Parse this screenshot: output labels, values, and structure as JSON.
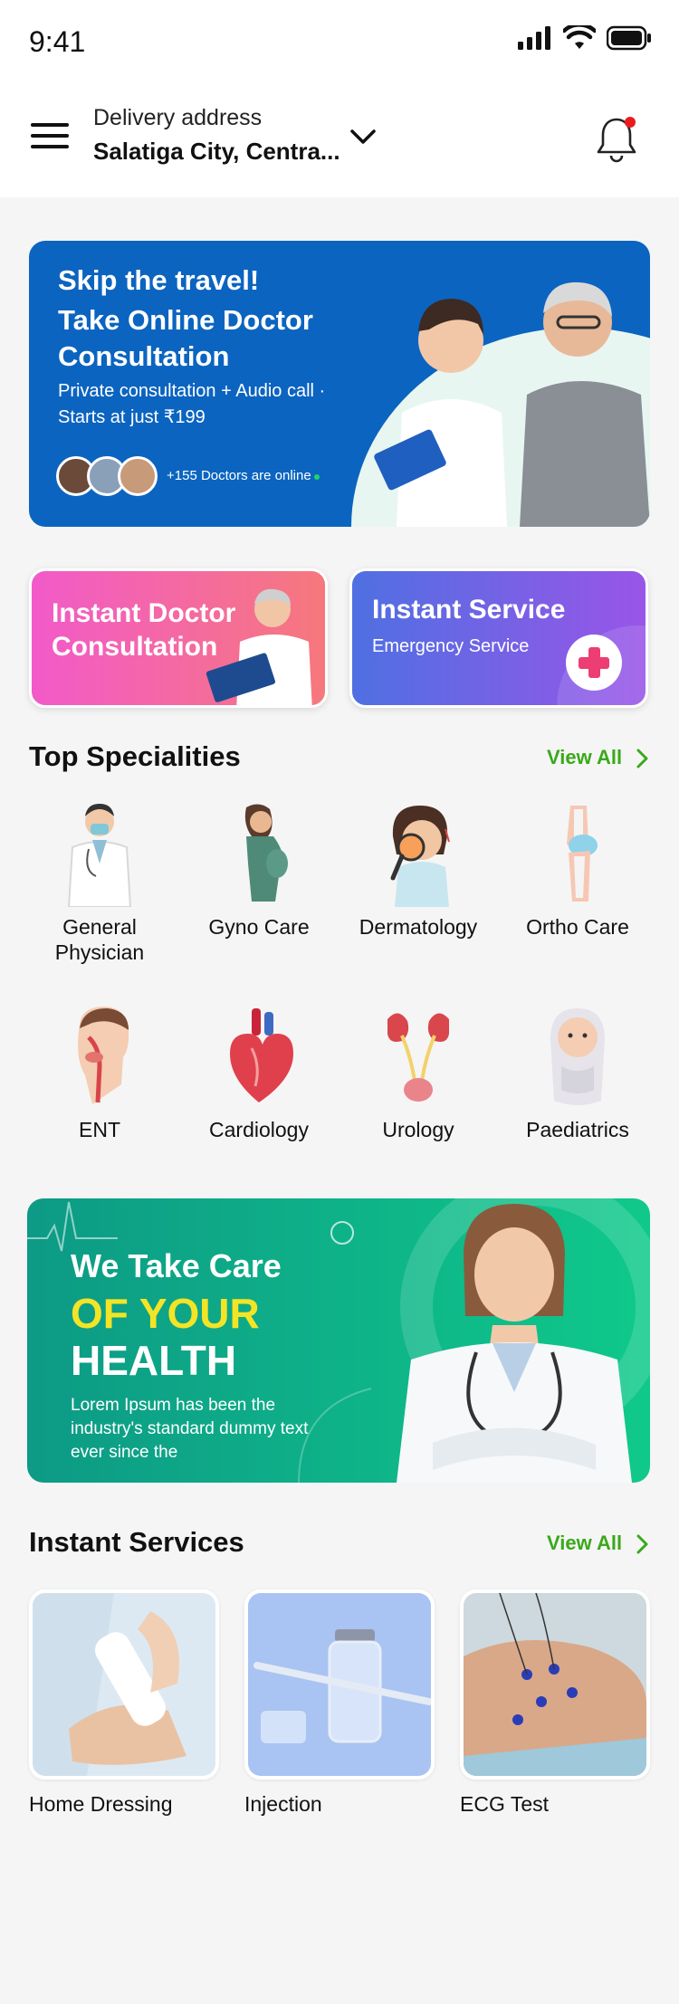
{
  "status_bar": {
    "time": "9:41"
  },
  "header": {
    "address_label": "Delivery address",
    "address_value": "Salatiga City, Centra...",
    "icons": [
      "menu-icon",
      "chevron-down-icon",
      "bell-icon"
    ],
    "notification_dot_color": "#e81c1c"
  },
  "hero": {
    "tagline": "Skip the travel!",
    "title": "Take Online Doctor Consultation",
    "subtitle": "Private consultation + Audio call · Starts at just ₹199",
    "online_text": "+155 Doctors are online",
    "background_color": "#0b64c0"
  },
  "quick_cards": [
    {
      "title": "Instant Doctor Consultation",
      "subtitle": ""
    },
    {
      "title": "Instant Service",
      "subtitle": "Emergency Service"
    }
  ],
  "specialities": {
    "title": "Top Specialities",
    "view_all": "View All",
    "items": [
      {
        "label": "General Physician",
        "icon": "doctor-icon"
      },
      {
        "label": "Gyno Care",
        "icon": "pregnant-woman-icon"
      },
      {
        "label": "Dermatology",
        "icon": "skin-magnifier-icon"
      },
      {
        "label": "Ortho Care",
        "icon": "knee-joint-icon"
      },
      {
        "label": "ENT",
        "icon": "ent-head-icon"
      },
      {
        "label": "Cardiology",
        "icon": "heart-icon"
      },
      {
        "label": "Urology",
        "icon": "kidneys-icon"
      },
      {
        "label": "Paediatrics",
        "icon": "baby-icon"
      }
    ]
  },
  "promo": {
    "line1": "We Take Care",
    "line2": "OF YOUR",
    "line3": "HEALTH",
    "body": "Lorem Ipsum has been the industry's standard dummy text ever since the",
    "accent_color": "#f4e426"
  },
  "instant_services": {
    "title": "Instant Services",
    "view_all": "View All",
    "items": [
      {
        "label": "Home Dressing"
      },
      {
        "label": "Injection"
      },
      {
        "label": "ECG Test"
      }
    ]
  },
  "colors": {
    "link_green": "#3aa91a",
    "page_bg": "#f5f5f5"
  }
}
